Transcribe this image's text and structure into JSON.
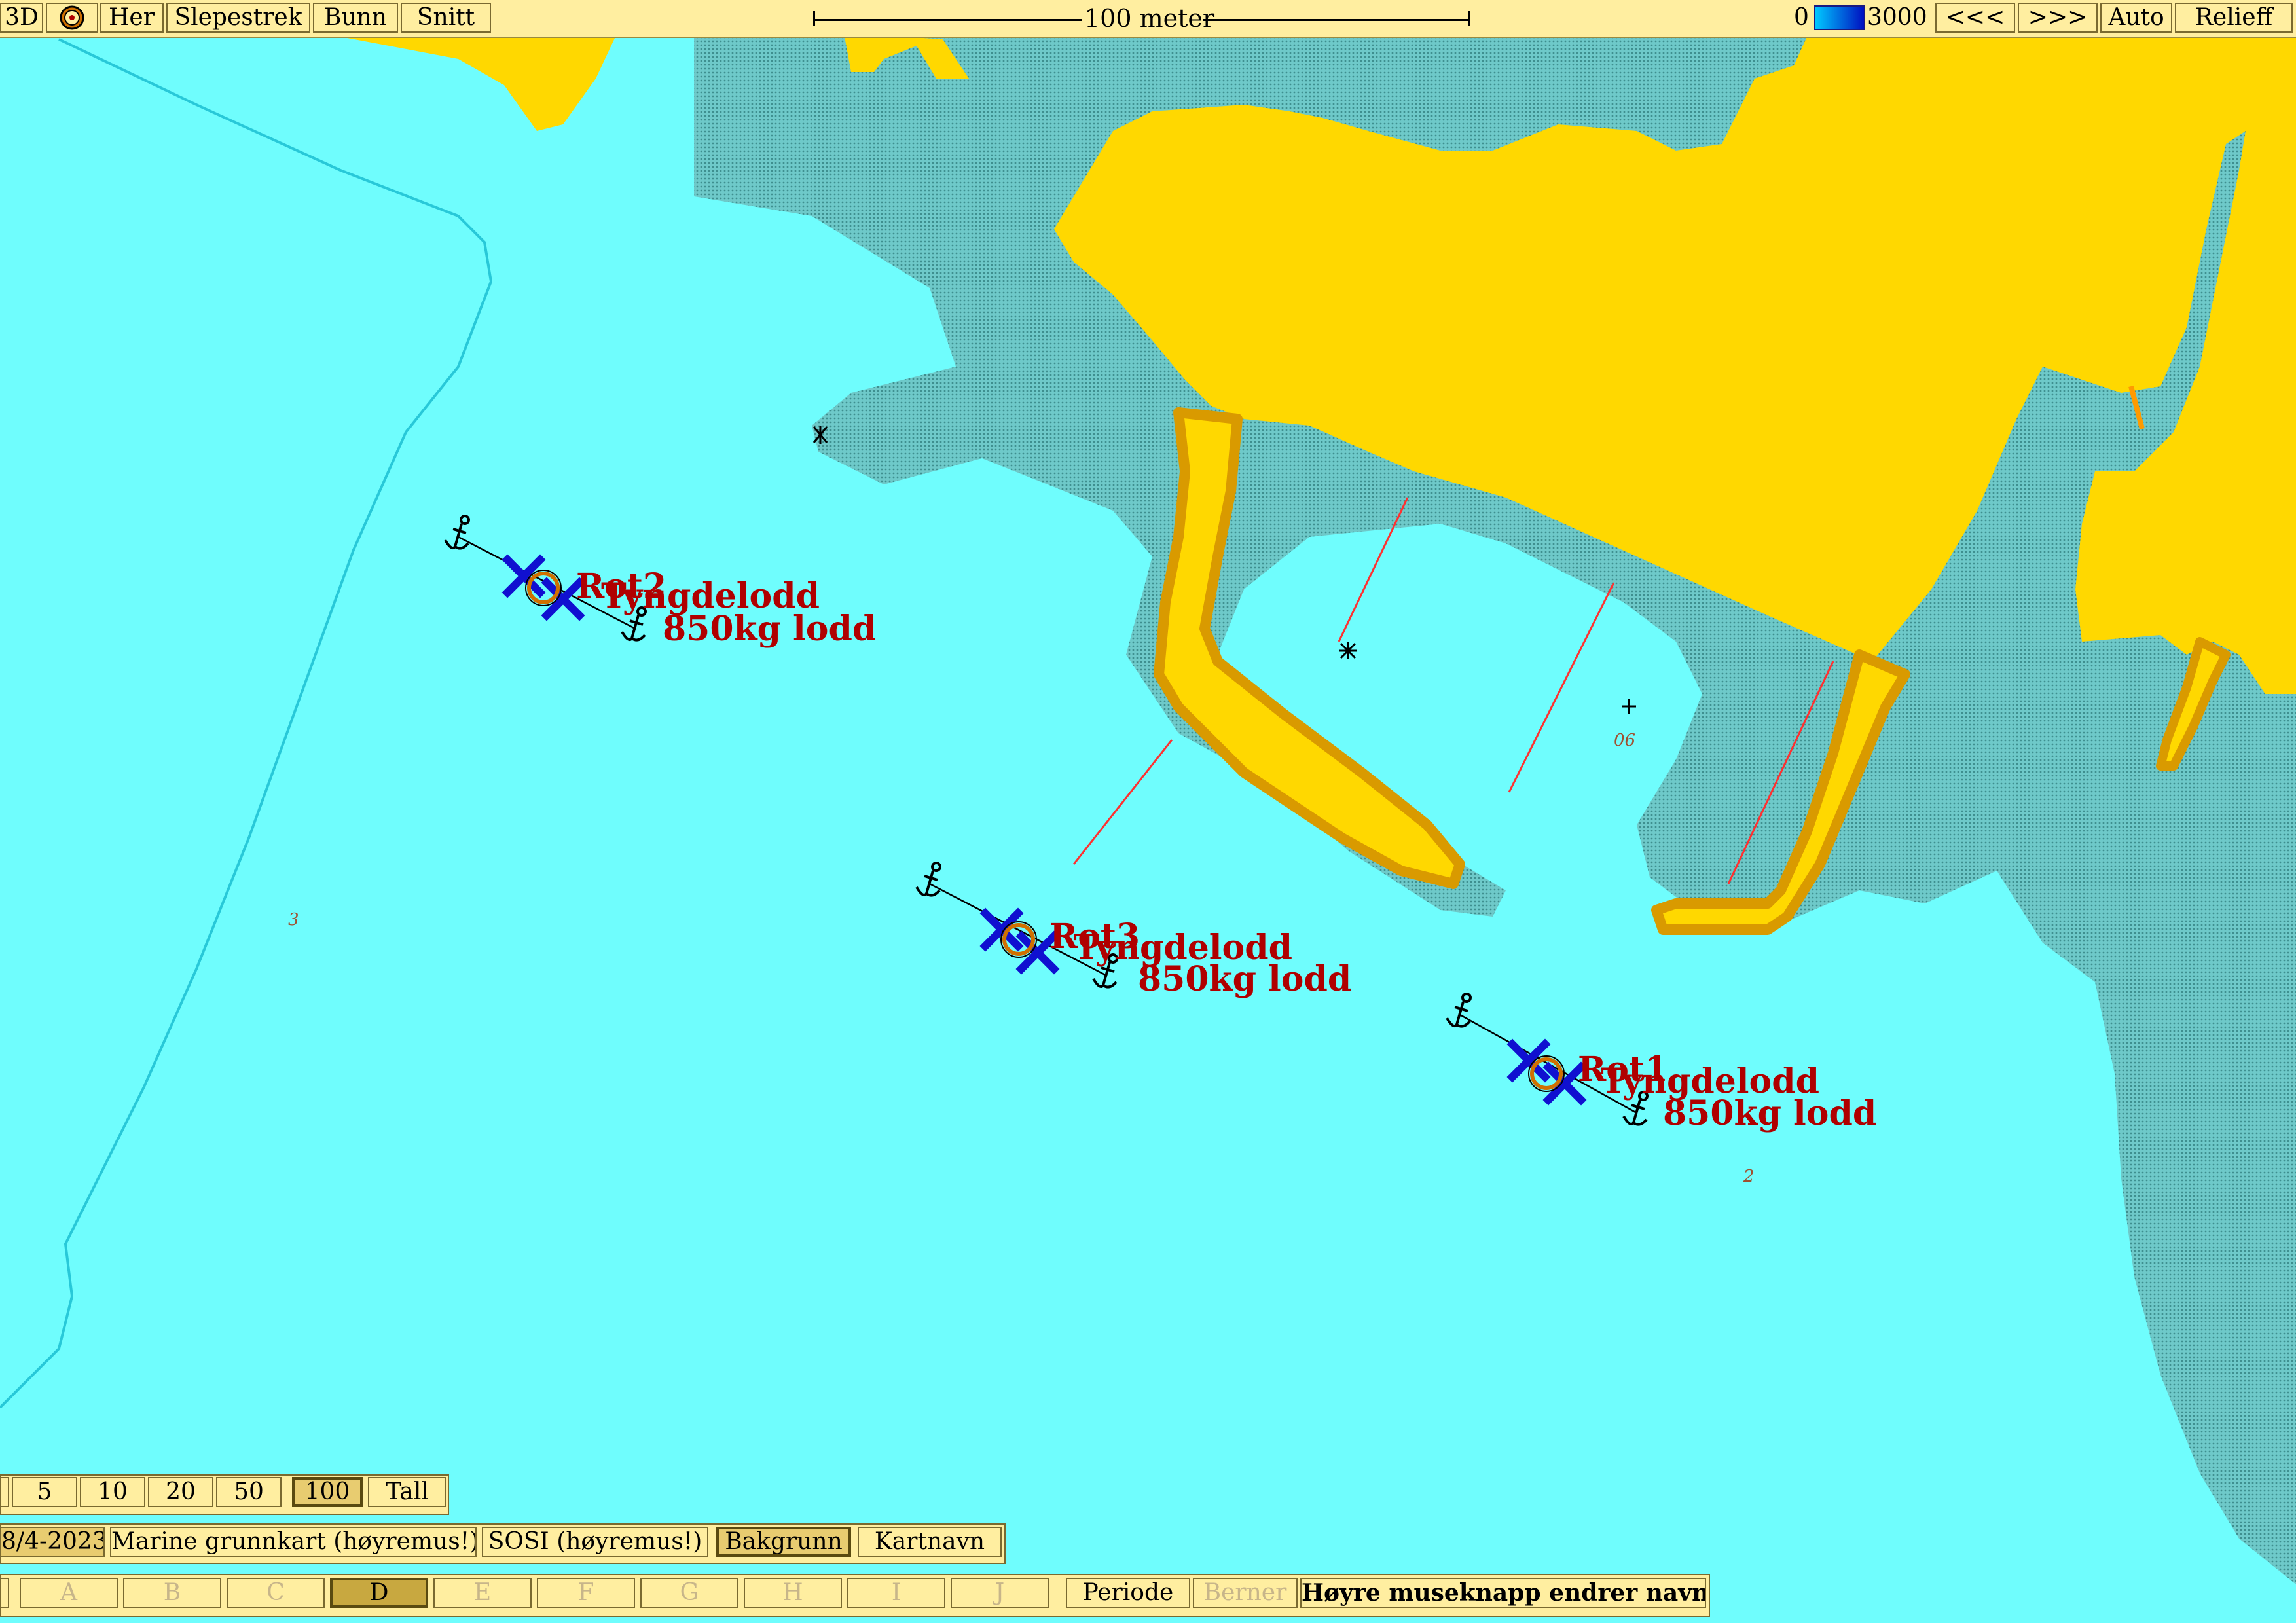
{
  "toolbar": {
    "btn_3d": "3D",
    "btn_her": "Her",
    "btn_slepestrek": "Slepestrek",
    "btn_bunn": "Bunn",
    "btn_snitt": "Snitt",
    "scale_label": "100 meter",
    "depth_min": "0",
    "depth_max": "3000",
    "btn_prev": "<<<",
    "btn_next": ">>>",
    "btn_auto": "Auto",
    "btn_relieff": "Relieff",
    "gradient_start": "#00c8ff",
    "gradient_end": "#0010c0"
  },
  "contour_row": {
    "options": [
      "5",
      "10",
      "20",
      "50",
      "100",
      "Tall"
    ],
    "selected": "100"
  },
  "layer_row": {
    "date": "8/4-2023",
    "marine": "Marine grunnkart (høyremus!)",
    "sosi": "SOSI (høyremus!)",
    "bakgrunn": "Bakgrunn",
    "kartnavn": "Kartnavn"
  },
  "letter_row": {
    "letters": [
      "A",
      "B",
      "C",
      "D",
      "E",
      "F",
      "G",
      "H",
      "I",
      "J"
    ],
    "selected": "D",
    "periode": "Periode",
    "berner": "Berner",
    "hint": "Høyre museknapp endrer navn"
  },
  "moorings": [
    {
      "name": "Rot2",
      "weight_label": "Tyngdelodd",
      "weight": "850kg lodd"
    },
    {
      "name": "Rot3",
      "weight_label": "Tyngdelodd",
      "weight": "850kg lodd"
    },
    {
      "name": "Rot1",
      "weight_label": "Tyngdelodd",
      "weight": "850kg lodd"
    }
  ],
  "depths": [
    "3",
    "06",
    "2"
  ],
  "colors": {
    "water": "#6ffdfd",
    "shallow": "#5fbcbc",
    "land": "#ffd800",
    "pier": "#d99a00",
    "label": "#b00000",
    "marker_x": "#1010d0"
  }
}
